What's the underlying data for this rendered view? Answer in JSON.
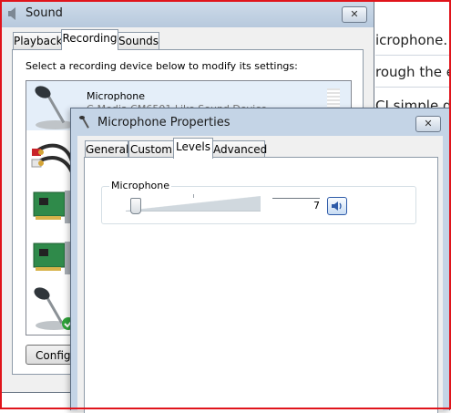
{
  "background_page": {
    "lines": [
      "icrophone.",
      "rough the e",
      "CI simple d"
    ]
  },
  "sound_dialog": {
    "title": "Sound",
    "close_label": "✕",
    "tabs": [
      {
        "label": "Playback"
      },
      {
        "label": "Recording",
        "active": true
      },
      {
        "label": "Sounds"
      }
    ],
    "instruction": "Select a recording device below to modify its settings:",
    "devices": [
      {
        "name": "Microphone",
        "description": "C-Media CM6501 Like Sound Device",
        "icon": "microphone-icon"
      },
      {
        "name": "",
        "description": "",
        "icon": "rca-cable-icon"
      },
      {
        "name": "",
        "description": "",
        "icon": "sound-card-icon"
      },
      {
        "name": "",
        "description": "",
        "icon": "sound-card-icon"
      },
      {
        "name": "",
        "description": "",
        "icon": "microphone-default-icon"
      }
    ],
    "configure_button": "Configure"
  },
  "mic_dialog": {
    "title": "Microphone Properties",
    "close_label": "✕",
    "tabs": [
      {
        "label": "General"
      },
      {
        "label": "Custom"
      },
      {
        "label": "Levels",
        "active": true
      },
      {
        "label": "Advanced"
      }
    ],
    "levels": {
      "group_label": "Microphone",
      "value": "7",
      "slider_fraction": 0.07
    }
  },
  "colors": {
    "highlight_border": "#e0141b",
    "title_bar": "#c4d4e6"
  }
}
